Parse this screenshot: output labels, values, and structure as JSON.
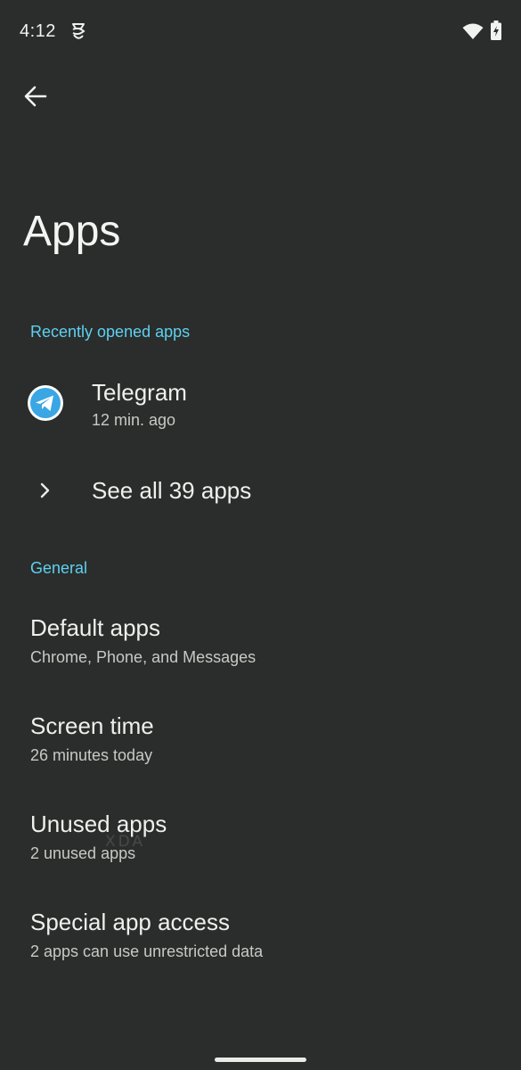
{
  "status_bar": {
    "time": "4:12",
    "icons": [
      "notification-icon",
      "wifi-icon",
      "battery-charging-icon"
    ]
  },
  "header": {
    "back_icon": "back-arrow-icon",
    "title": "Apps"
  },
  "recent": {
    "section_label": "Recently opened apps",
    "apps": [
      {
        "name": "Telegram",
        "subtitle": "12 min. ago",
        "icon": "telegram-icon"
      }
    ],
    "see_all_label": "See all 39 apps"
  },
  "general": {
    "section_label": "General",
    "items": [
      {
        "title": "Default apps",
        "subtitle": "Chrome, Phone, and Messages"
      },
      {
        "title": "Screen time",
        "subtitle": "26 minutes today"
      },
      {
        "title": "Unused apps",
        "subtitle": "2 unused apps"
      },
      {
        "title": "Special app access",
        "subtitle": "2 apps can use unrestricted data"
      }
    ]
  },
  "watermark": "XDA",
  "colors": {
    "background": "#2a2d2b",
    "accent": "#5ed0f2",
    "telegram": "#3aa6e3"
  }
}
